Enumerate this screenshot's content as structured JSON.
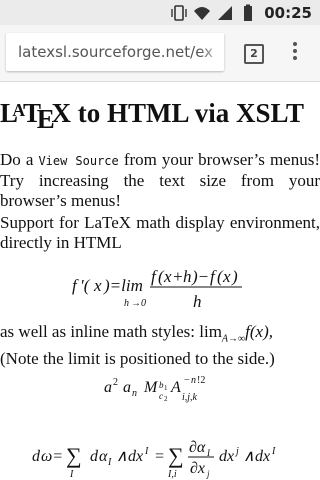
{
  "status_bar": {
    "icons": [
      "vibrate-icon",
      "wifi-icon",
      "signal-icon",
      "battery-icon"
    ],
    "time": "00:25"
  },
  "browser": {
    "url": "latexsl.sourceforge.net/ex",
    "tab_count": "2",
    "menu_icon": "overflow-menu-icon"
  },
  "content": {
    "heading_logo_L": "L",
    "heading_logo_A": "A",
    "heading_logo_T": "T",
    "heading_logo_E": "E",
    "heading_logo_X": "X",
    "heading_rest": " to HTML via XSLT",
    "p1_do_a": "Do a ",
    "p1_view_source": "View Source",
    "p1_rest": " from your browser’s menus! Try increasing the text size from your browser’s menus!",
    "p2": "Support for LaTeX math display environment, directly in HTML",
    "p3_start": "as well as inline math styles: ",
    "p3_lim": "lim",
    "p3_sub": "A→∞",
    "p3_f": "f(x),",
    "p3_note": "(Note the limit is positioned to the side.)"
  }
}
